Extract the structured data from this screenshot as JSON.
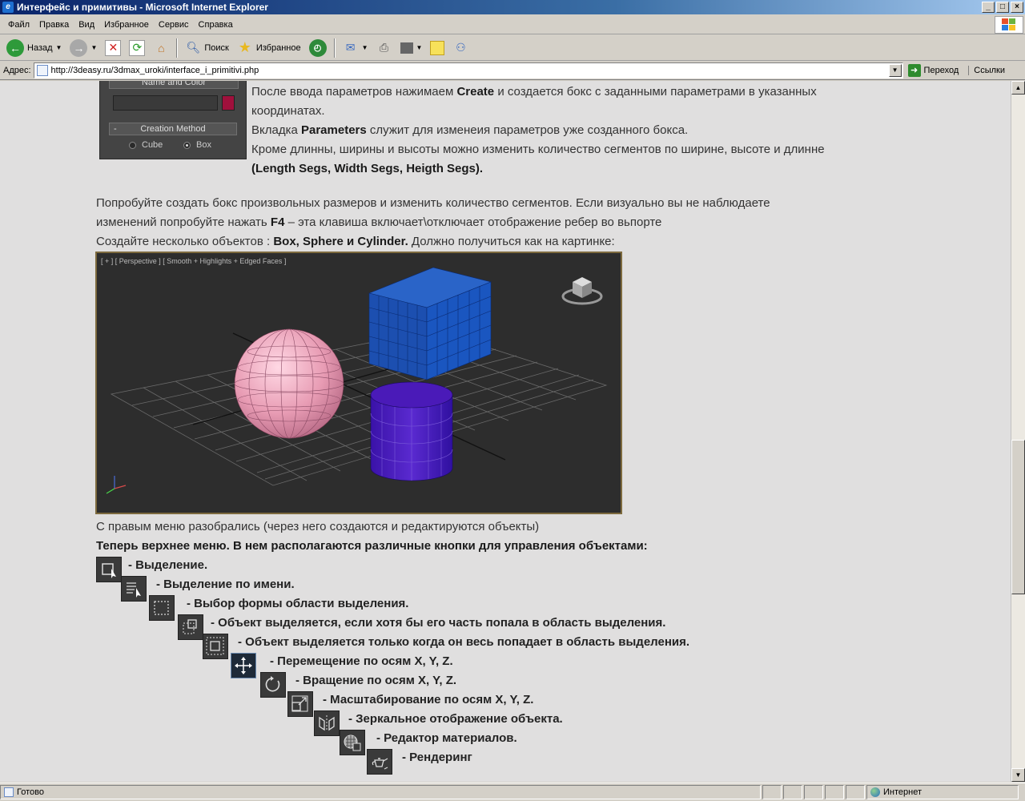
{
  "window": {
    "title": "Интерфейс и примитивы - Microsoft Internet Explorer",
    "min": "_",
    "max": "□",
    "close": "×"
  },
  "menu": [
    "Файл",
    "Правка",
    "Вид",
    "Избранное",
    "Сервис",
    "Справка"
  ],
  "toolbar": {
    "back": "Назад",
    "search": "Поиск",
    "favorites": "Избранное"
  },
  "address": {
    "label": "Адрес:",
    "url": "http://3deasy.ru/3dmax_uroki/interface_i_primitivi.php",
    "go": "Переход",
    "links": "Ссылки"
  },
  "max_panel": {
    "name_color": "Name and Color",
    "creation_method": "Creation Method",
    "cube": "Cube",
    "box": "Box",
    "minus": "-"
  },
  "para1": {
    "l1_pre": "После ввода параметров нажимаем ",
    "l1_b": "Create",
    "l1_post": " и создается бокс с заданными параметрами в указанных",
    "l2": "координатах.",
    "l3_pre": "Вкладка ",
    "l3_b": "Parameters",
    "l3_post": " служит для изменеия параметров уже созданного бокса.",
    "l4": "Кроме длинны, ширины и высоты можно изменить количество сегментов по ширине, высоте и длинне",
    "l5_b": "(Length Segs, Width Segs, Heigth Segs)."
  },
  "para2": {
    "l1": "Попробуйте создать бокс произвольных размеров и изменить количество сегментов. Если визуально вы не наблюдаете",
    "l2_pre": "изменений попробуйте нажать ",
    "l2_b": "F4",
    "l2_post": " – эта клавиша включает\\отключает отображение ребер во вьпорте",
    "l3_pre": "Создайте несколько объектов : ",
    "l3_b": "Box, Sphere и Cylinder.",
    "l3_post": " Должно получиться как на картинке:"
  },
  "viewport": {
    "label": "[ + ] [ Perspective ] [ Smooth + Highlights + Edged Faces ]"
  },
  "para3": {
    "l1": "С правым меню разобрались (через него создаются и редактируются объекты)",
    "l2": "Теперь верхнее меню. В нем располагаются различные кнопки для управления объектами:"
  },
  "tools": [
    {
      "label": "- Выделение."
    },
    {
      "label": "- Выделение по имени."
    },
    {
      "label": "- Выбор формы области выделения."
    },
    {
      "label": "- Объект выделяется, если хотя бы его часть попала в область выделения."
    },
    {
      "label": "- Объект выделяется только когда он весь попадает в область выделения."
    },
    {
      "label": "- Перемещение по осям X, Y, Z."
    },
    {
      "label": "- Вращение по осям X, Y, Z."
    },
    {
      "label": "- Масштабирование по осям X, Y, Z."
    },
    {
      "label": "- Зеркальное отображение объекта."
    },
    {
      "label": "- Редактор материалов."
    },
    {
      "label": "- Рендеринг"
    }
  ],
  "status": {
    "text": "Готово",
    "zone": "Интернет"
  }
}
